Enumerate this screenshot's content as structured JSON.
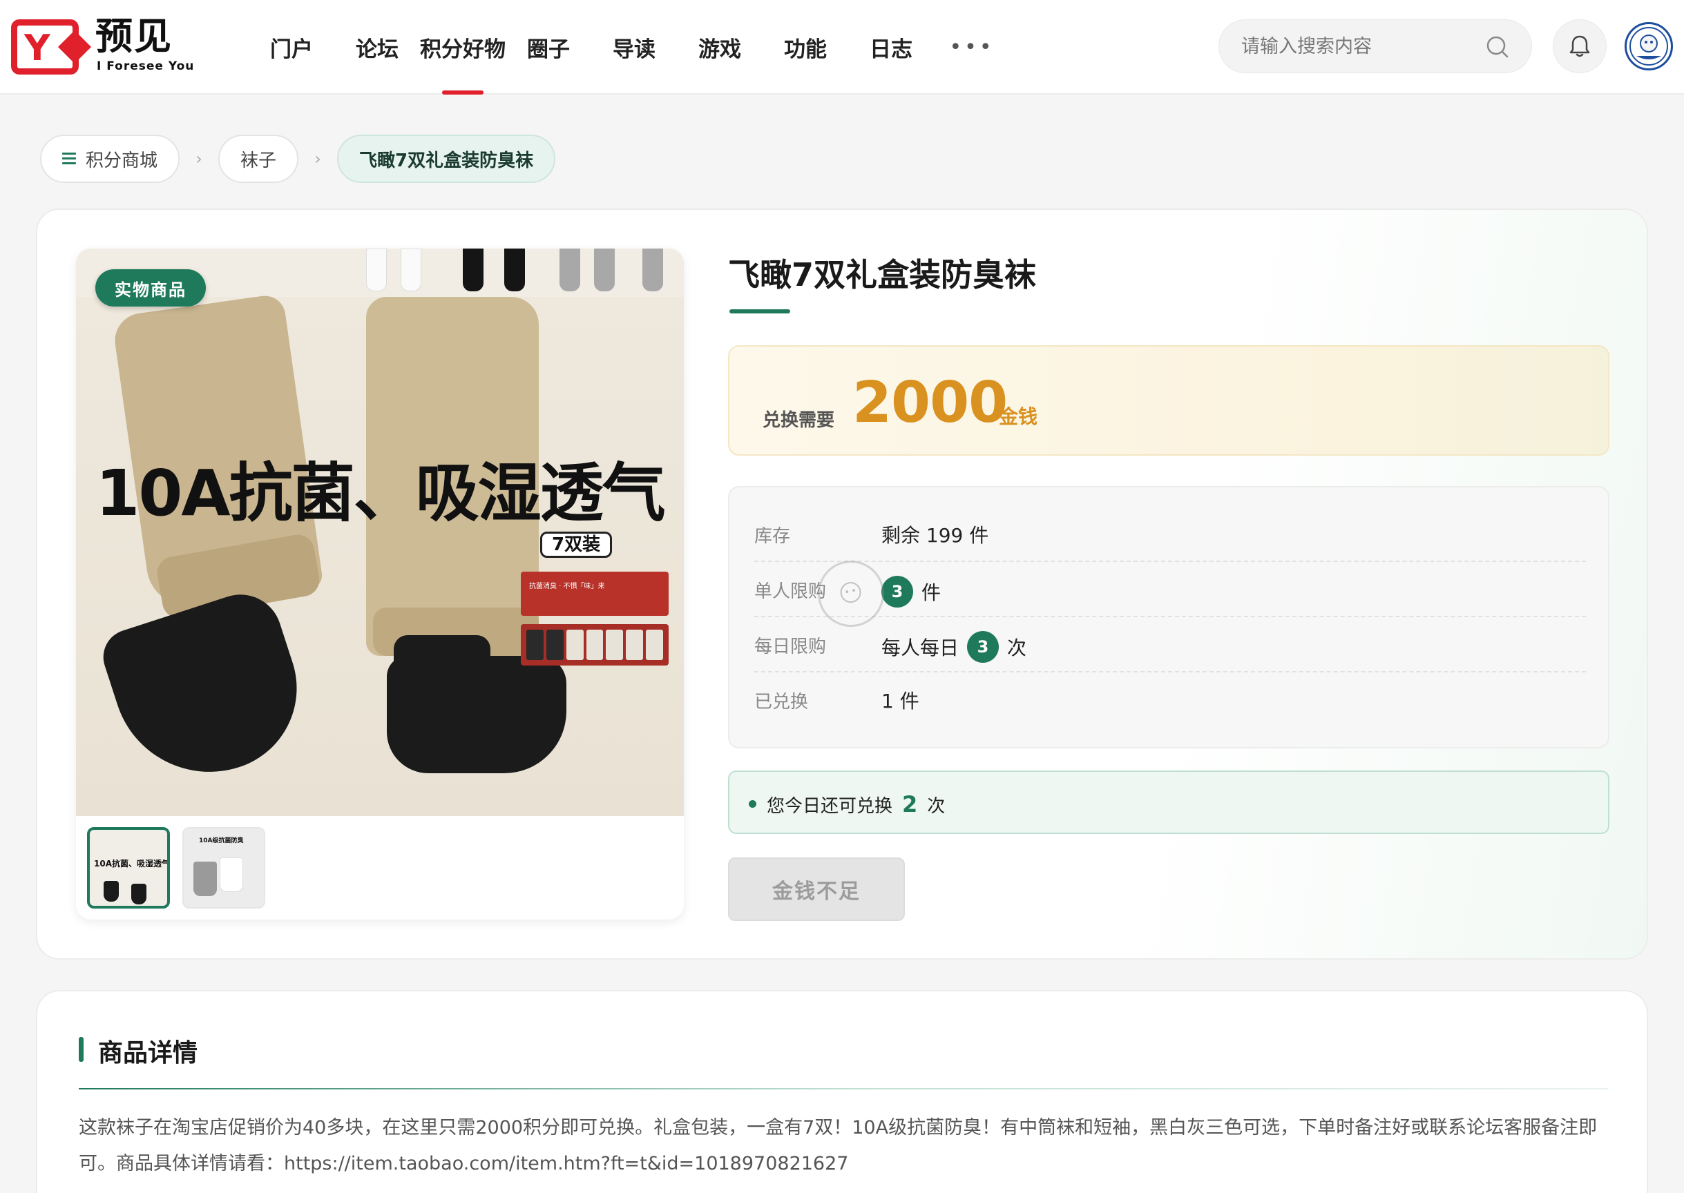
{
  "header": {
    "logo_text": "预见",
    "logo_sub": "I Foresee You",
    "logo_letter": "Y",
    "nav": [
      {
        "label": "门户"
      },
      {
        "label": "论坛"
      },
      {
        "label": "积分好物",
        "active": true
      },
      {
        "label": "圈子"
      },
      {
        "label": "导读"
      },
      {
        "label": "游戏"
      },
      {
        "label": "功能"
      },
      {
        "label": "日志"
      }
    ],
    "nav_more": "•••",
    "search_placeholder": "请输入搜索内容",
    "icons": {
      "search": "search-icon",
      "bell": "bell-icon",
      "avatar": "avatar"
    },
    "accent_color": "#e0202b"
  },
  "breadcrumb": {
    "items": [
      "积分商城",
      "袜子",
      "飞瞰7双礼盒装防臭袜"
    ],
    "separator": "›"
  },
  "product": {
    "tag": "实物商品",
    "image_text": {
      "headline": "10A抗菌、吸湿透气",
      "pack": "7双装",
      "box_text": "抗菌消臭 · 不惧「味」来"
    },
    "thumbnails": [
      {
        "text": "10A抗菌、吸湿透气"
      },
      {
        "text": "10A级抗菌防臭"
      }
    ],
    "title": "飞瞰7双礼盒装防臭袜",
    "price": {
      "label": "兑换需要",
      "value": "2000",
      "unit": "金钱"
    },
    "stats": {
      "stock_label": "库存",
      "stock_value": "剩余 199 件",
      "per_user_label": "单人限购",
      "per_user_num": "3",
      "per_user_unit": "件",
      "daily_label": "每日限购",
      "daily_prefix": "每人每日",
      "daily_num": "3",
      "daily_unit": "次",
      "redeemed_label": "已兑换",
      "redeemed_value": "1 件"
    },
    "notice": {
      "prefix": "您今日还可兑换",
      "num": "2",
      "suffix": "次"
    },
    "button_label": "金钱不足",
    "theme_color": "#1f7a5c",
    "price_color": "#d9911f"
  },
  "details": {
    "title": "商品详情",
    "text": "这款袜子在淘宝店促销价为40多块，在这里只需2000积分即可兑换。礼盒包装，一盒有7双！10A级抗菌防臭！有中筒袜和短袖，黑白灰三色可选，下单时备注好或联系论坛客服备注即可。商品具体详情请看：https://item.taobao.com/item.htm?ft=t&id=1018970821627"
  }
}
